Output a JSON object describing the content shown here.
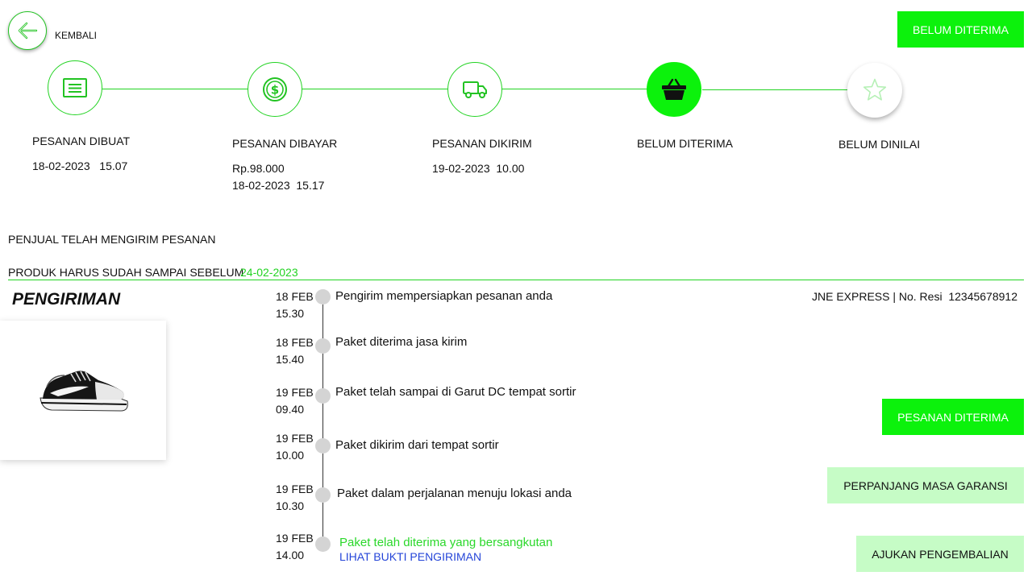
{
  "header": {
    "back_label": "KEMBALI",
    "status_button": "BELUM DITERIMA"
  },
  "steps": [
    {
      "label": "PESANAN DIBUAT",
      "detail1": "18-02-2023   15.07",
      "detail2": "",
      "icon": "receipt-icon"
    },
    {
      "label": "PESANAN DIBAYAR",
      "detail1": "Rp.98.000",
      "detail2": "18-02-2023  15.17",
      "icon": "dollar-coin-icon"
    },
    {
      "label": "PESANAN DIKIRIM",
      "detail1": "19-02-2023  10.00",
      "detail2": "",
      "icon": "truck-icon"
    },
    {
      "label": "BELUM DITERIMA",
      "detail1": "",
      "detail2": "",
      "icon": "basket-icon"
    },
    {
      "label": "BELUM DINILAI",
      "detail1": "",
      "detail2": "",
      "icon": "star-icon"
    }
  ],
  "info": {
    "seller_sent": "PENJUAL TELAH MENGIRIM PESANAN",
    "deadline_label": "PRODUK HARUS SUDAH SAMPAI SEBELUM",
    "deadline_date": "24-02-2023"
  },
  "shipping": {
    "title": "PENGIRIMAN",
    "courier": "JNE EXPRESS | No. Resi  12345678912",
    "events": [
      {
        "date": "18 FEB",
        "time": "15.30",
        "text": "Pengirim mempersiapkan pesanan anda"
      },
      {
        "date": "18 FEB",
        "time": "15.40",
        "text": "Paket diterima jasa kirim"
      },
      {
        "date": "19 FEB",
        "time": "09.40",
        "text": "Paket telah sampai di Garut DC tempat sortir"
      },
      {
        "date": "19 FEB",
        "time": "10.00",
        "text": "Paket dikirim dari tempat sortir"
      },
      {
        "date": "19 FEB",
        "time": "10.30",
        "text": "Paket dalam perjalanan menuju lokasi anda"
      },
      {
        "date": "19 FEB",
        "time": "14.00",
        "text": "Paket telah diterima yang bersangkutan"
      }
    ],
    "proof_link": "LIHAT BUKTI PENGIRIMAN"
  },
  "actions": {
    "received": "PESANAN DITERIMA",
    "extend_warranty": "PERPANJANG MASA GARANSI",
    "request_return": "AJUKAN PENGEMBALIAN"
  },
  "colors": {
    "accent": "#0cf20c",
    "accent_light": "#c6fcc6",
    "link": "#2545d8",
    "delivered_text": "#2ad82a"
  }
}
